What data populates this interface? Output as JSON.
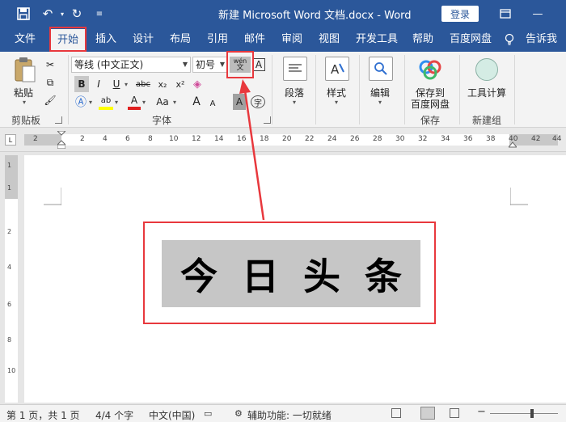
{
  "titlebar": {
    "title": "新建 Microsoft Word 文档.docx  -  Word",
    "login_label": "登录",
    "save_icon": "save-icon",
    "undo_icon": "undo-icon",
    "redo_icon": "redo-icon"
  },
  "tabs": [
    {
      "label": "文件"
    },
    {
      "label": "开始"
    },
    {
      "label": "插入"
    },
    {
      "label": "设计"
    },
    {
      "label": "布局"
    },
    {
      "label": "引用"
    },
    {
      "label": "邮件"
    },
    {
      "label": "审阅"
    },
    {
      "label": "视图"
    },
    {
      "label": "开发工具"
    },
    {
      "label": "帮助"
    },
    {
      "label": "百度网盘"
    },
    {
      "label": "告诉我"
    }
  ],
  "ribbon": {
    "clipboard": {
      "paste_label": "粘贴",
      "group_label": "剪贴板"
    },
    "font": {
      "font_name": "等线 (中文正文)",
      "font_size": "初号",
      "group_label": "字体",
      "bold": "B",
      "italic": "I",
      "underline": "U",
      "strike": "abc",
      "subscript": "x₂",
      "superscript": "x²",
      "phonetic_top": "wén",
      "phonetic_bottom": "文",
      "border_char": "A",
      "change_case": "Aa",
      "grow": "A",
      "shrink": "A",
      "shading": "A",
      "enclose": "字"
    },
    "paragraph": {
      "label": "段落"
    },
    "styles": {
      "label": "样式"
    },
    "editing": {
      "label": "编辑"
    },
    "save": {
      "label_line1": "保存到",
      "label_line2": "百度网盘",
      "group_label": "保存"
    },
    "tools": {
      "label": "工具计算",
      "group_label": "新建组"
    }
  },
  "ruler": {
    "ticks": [
      "2",
      "2",
      "4",
      "6",
      "8",
      "10",
      "12",
      "14",
      "16",
      "18",
      "20",
      "22",
      "24",
      "26",
      "28",
      "30",
      "32",
      "34",
      "36",
      "38",
      "40",
      "42",
      "44"
    ],
    "vticks": [
      "1",
      "1",
      "2",
      "4",
      "6",
      "8",
      "10"
    ]
  },
  "document": {
    "chars": [
      "今",
      "日",
      "头",
      "条"
    ]
  },
  "status": {
    "page": "第 1 页，共 1 页",
    "words": "4/4 个字",
    "language": "中文(中国)",
    "accessibility": "辅助功能: 一切就绪"
  }
}
